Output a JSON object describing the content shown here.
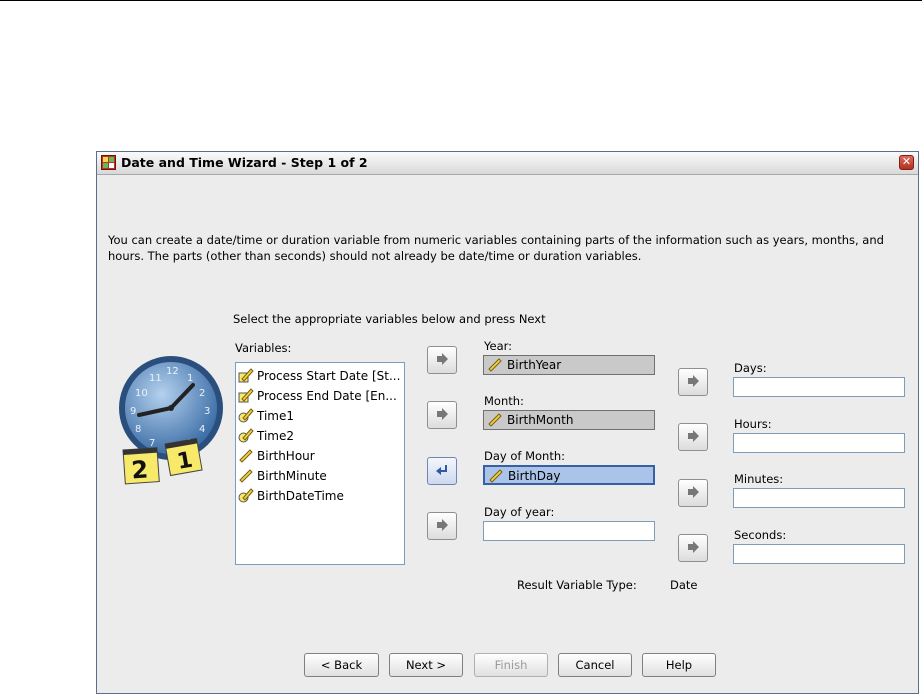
{
  "dialog": {
    "title": "Date and Time Wizard - Step 1 of 2",
    "intro": "You can create a date/time or duration variable from numeric variables containing parts of the information such as years, months, and hours. The parts (other than seconds) should not already be date/time or duration variables.",
    "instructions": "Select the appropriate variables below and press Next"
  },
  "variables": {
    "label": "Variables:",
    "items": [
      {
        "label": "Process Start Date [St...",
        "type": "date"
      },
      {
        "label": "Process End Date [En...",
        "type": "date"
      },
      {
        "label": "Time1",
        "type": "time"
      },
      {
        "label": "Time2",
        "type": "time"
      },
      {
        "label": "BirthHour",
        "type": "scale"
      },
      {
        "label": "BirthMinute",
        "type": "scale"
      },
      {
        "label": "BirthDateTime",
        "type": "time"
      }
    ]
  },
  "fields": {
    "year": {
      "label": "Year:",
      "value": "BirthYear"
    },
    "month": {
      "label": "Month:",
      "value": "BirthMonth"
    },
    "day_of_month": {
      "label": "Day of Month:",
      "value": "BirthDay"
    },
    "day_of_year": {
      "label": "Day of year:",
      "value": ""
    },
    "days": {
      "label": "Days:",
      "value": ""
    },
    "hours": {
      "label": "Hours:",
      "value": ""
    },
    "minutes": {
      "label": "Minutes:",
      "value": ""
    },
    "seconds": {
      "label": "Seconds:",
      "value": ""
    }
  },
  "result": {
    "label": "Result Variable Type:",
    "value": "Date"
  },
  "buttons": {
    "back": "< Back",
    "next": "Next >",
    "finish": "Finish",
    "cancel": "Cancel",
    "help": "Help"
  },
  "colors": {
    "selection": "#abc3e8",
    "filled_field": "#c9c9c9",
    "dialog_bg": "#ececec"
  }
}
